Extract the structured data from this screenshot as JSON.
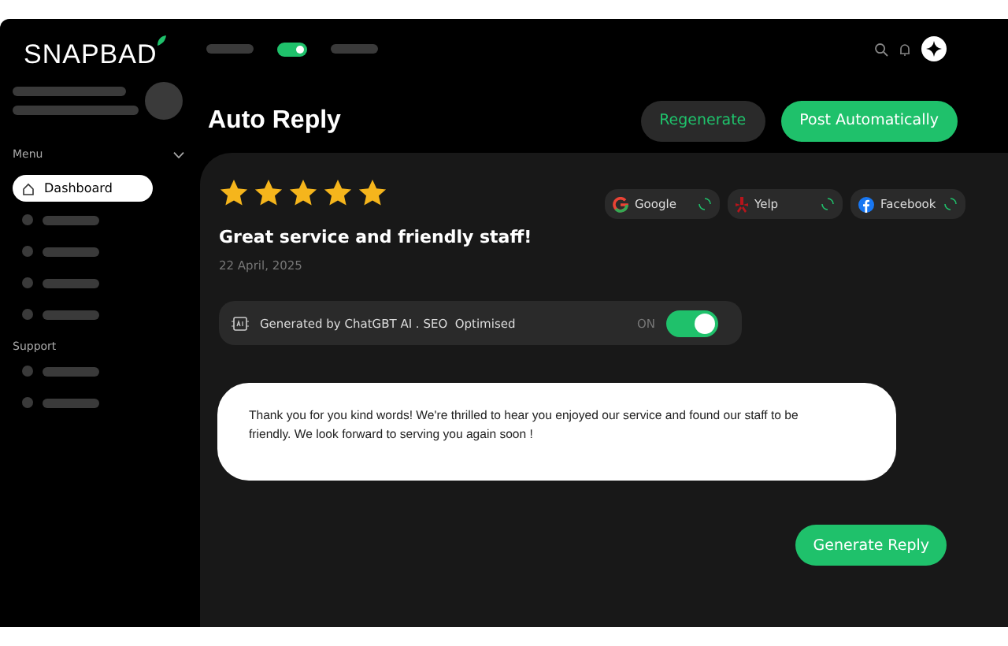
{
  "logo": "SNAPBAD",
  "top_nav": {
    "toggle_on": true
  },
  "sidebar": {
    "menu_label": "Menu",
    "menu_expanded": true,
    "items": [
      {
        "kind": "link",
        "label": "Dashboard",
        "selected": true
      },
      {
        "kind": "placeholder",
        "selected": false
      },
      {
        "kind": "placeholder",
        "selected": false
      },
      {
        "kind": "placeholder",
        "selected": false
      },
      {
        "kind": "placeholder",
        "selected": false
      }
    ],
    "support_label": "Support",
    "support_items": [
      {
        "kind": "placeholder",
        "selected": false
      },
      {
        "kind": "placeholder",
        "selected": false
      }
    ]
  },
  "page_title": "Auto Reply",
  "actions": [
    {
      "kind": "secondary",
      "label": "Regenerate"
    },
    {
      "kind": "primary",
      "label": "Post Automatically"
    }
  ],
  "review": {
    "stars": 5,
    "title": "Great service and friendly staff!",
    "date": "22 April, 2025",
    "platforms": [
      {
        "kind": "google",
        "label": "Google"
      },
      {
        "kind": "yelp",
        "label": "Yelp"
      },
      {
        "kind": "facebook",
        "label": "Facebook"
      }
    ]
  },
  "generated": {
    "label": "Generated by ChatGBT AI . SEO  Optimised",
    "state_label": "ON",
    "on": true
  },
  "reply": "Thank you for you kind words! We're thrilled to hear you enjoyed our service and found our staff to be friendly. We look forward to serving you again soon !",
  "generate_button": "Generate Reply"
}
